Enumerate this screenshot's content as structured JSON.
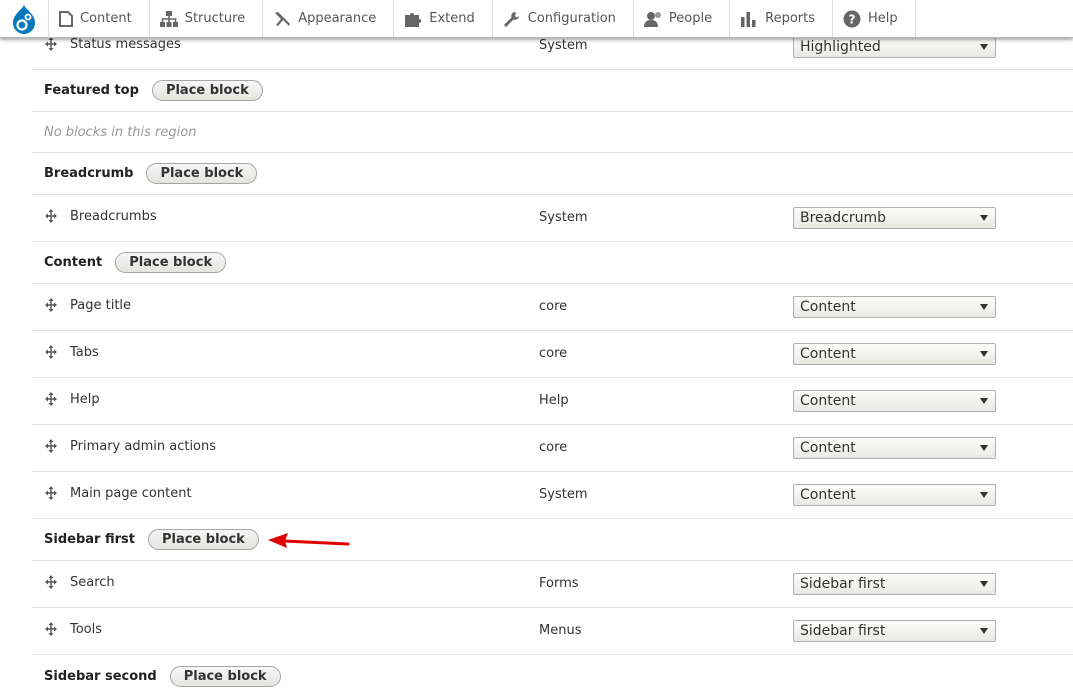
{
  "toolbar": {
    "items": [
      {
        "label": "Content",
        "icon": "content-icon"
      },
      {
        "label": "Structure",
        "icon": "structure-icon"
      },
      {
        "label": "Appearance",
        "icon": "appearance-icon"
      },
      {
        "label": "Extend",
        "icon": "extend-icon"
      },
      {
        "label": "Configuration",
        "icon": "configuration-icon"
      },
      {
        "label": "People",
        "icon": "people-icon"
      },
      {
        "label": "Reports",
        "icon": "reports-icon"
      },
      {
        "label": "Help",
        "icon": "help-icon"
      }
    ]
  },
  "place_block_label": "Place block",
  "empty_region_text": "No blocks in this region",
  "rows": {
    "status": {
      "name": "Status messages",
      "category": "System",
      "region": "Highlighted"
    },
    "featured_top": {
      "title": "Featured top"
    },
    "breadcrumb": {
      "title": "Breadcrumb"
    },
    "breadcrumbs": {
      "name": "Breadcrumbs",
      "category": "System",
      "region": "Breadcrumb"
    },
    "content": {
      "title": "Content"
    },
    "page_title": {
      "name": "Page title",
      "category": "core",
      "region": "Content"
    },
    "tabs": {
      "name": "Tabs",
      "category": "core",
      "region": "Content"
    },
    "help": {
      "name": "Help",
      "category": "Help",
      "region": "Content"
    },
    "primary_admin": {
      "name": "Primary admin actions",
      "category": "core",
      "region": "Content"
    },
    "main_content": {
      "name": "Main page content",
      "category": "System",
      "region": "Content"
    },
    "sidebar_first": {
      "title": "Sidebar first"
    },
    "search": {
      "name": "Search",
      "category": "Forms",
      "region": "Sidebar first"
    },
    "tools": {
      "name": "Tools",
      "category": "Menus",
      "region": "Sidebar first"
    },
    "sidebar_second": {
      "title": "Sidebar second"
    }
  },
  "colors": {
    "drupal_blue": "#0678be",
    "annotation_red": "#e00000"
  }
}
